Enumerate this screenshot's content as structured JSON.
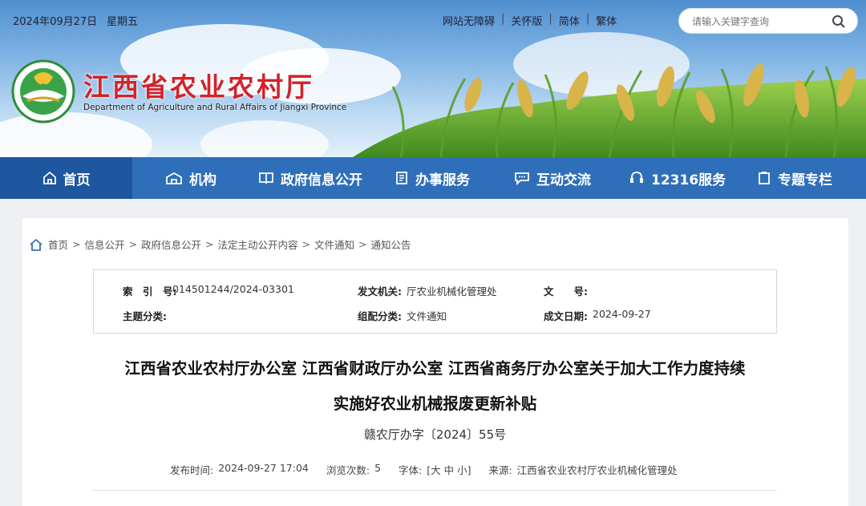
{
  "header": {
    "date": "2024年09月27日",
    "weekday": "星期五",
    "links": [
      "网站无障碍",
      "关怀版",
      "简体",
      "繁体"
    ],
    "search_placeholder": "请输入关键字查询",
    "site_name": "江西省农业农村厅",
    "site_name_en": "Department of Agriculture and Rural Affairs of Jiangxi Province"
  },
  "nav": {
    "items": [
      {
        "label": "首页",
        "icon": "home-icon"
      },
      {
        "label": "机构",
        "icon": "building-icon"
      },
      {
        "label": "政府信息公开",
        "icon": "book-icon"
      },
      {
        "label": "办事服务",
        "icon": "document-icon"
      },
      {
        "label": "互动交流",
        "icon": "chat-icon"
      },
      {
        "label": "12316服务",
        "icon": "headset-icon"
      },
      {
        "label": "专题专栏",
        "icon": "clipboard-icon"
      }
    ],
    "active_color": "#1e56a0",
    "bar_color": "#2f6fba"
  },
  "breadcrumb": [
    "首页",
    "信息公开",
    "政府信息公开",
    "法定主动公开内容",
    "文件通知",
    "通知公告"
  ],
  "meta": {
    "index_label": "索　引　号:",
    "index_value": "014501244/2024-03301",
    "issuer_label": "发文机关:",
    "issuer_value": "厅农业机械化管理处",
    "docnum_label": "文　　号:",
    "docnum_value": "",
    "topic_label": "主题分类:",
    "topic_value": "",
    "category_label": "组配分类:",
    "category_value": "文件通知",
    "date_label": "成文日期:",
    "date_value": "2024-09-27"
  },
  "article": {
    "title_line1": "江西省农业农村厅办公室 江西省财政厅办公室 江西省商务厅办公室关于加大工作力度持续",
    "title_line2": "实施好农业机械报废更新补贴",
    "doc_number": "赣农厅办字〔2024〕55号",
    "publish_label": "发布时间:",
    "publish_value": "2024-09-27 17:04",
    "views_label": "浏览次数:",
    "views_value": "5",
    "font_label": "字体:",
    "font_value": "[大 中 小]",
    "source_label": "来源:",
    "source_value": "江西省农业农村厅农业机械化管理处"
  }
}
